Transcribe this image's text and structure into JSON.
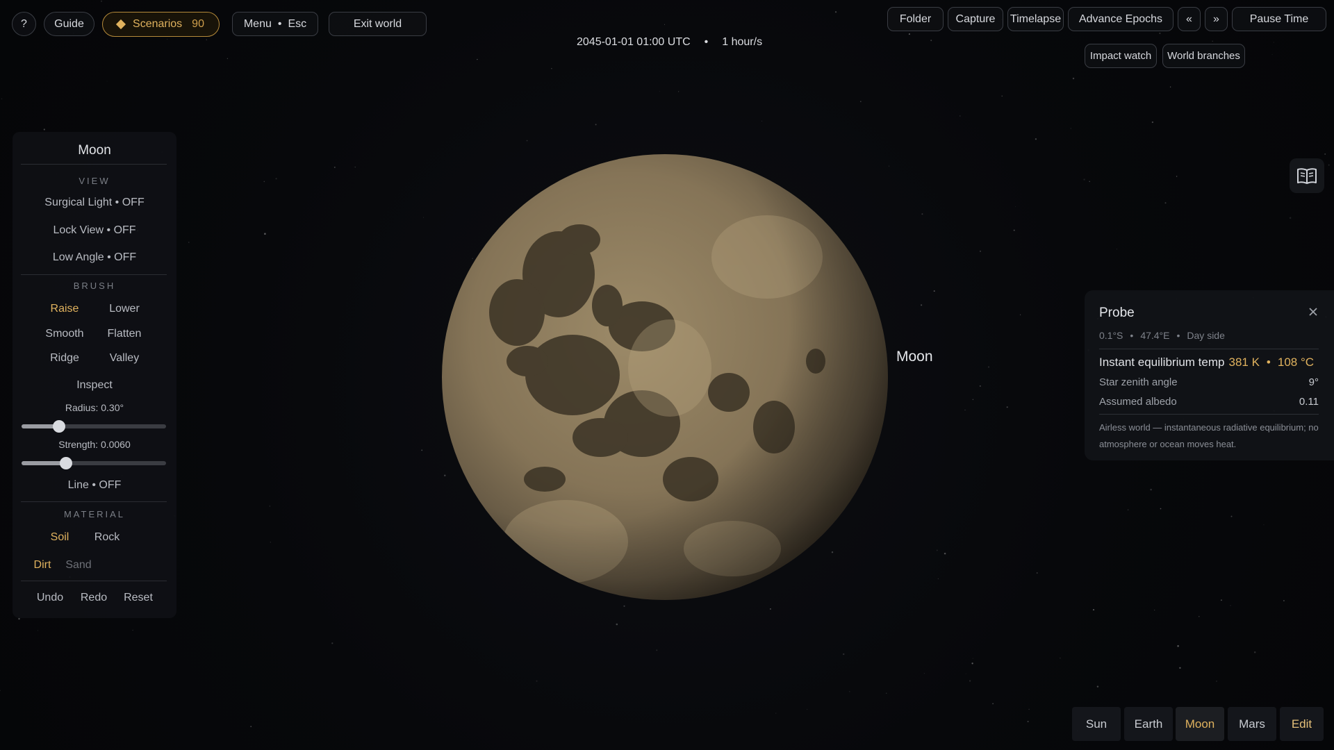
{
  "colors": {
    "accent": "#e0b25e",
    "background": "#06070a",
    "panel": "#101115",
    "text": "#cfd2d8",
    "moon_surface": "#8a7a5c"
  },
  "topbar_left": {
    "help_label": "?",
    "guide_label": "Guide",
    "scenarios_label": "Scenarios",
    "scenarios_count": "90",
    "menu_label": "Menu",
    "menu_key": "Esc",
    "exit_label": "Exit world"
  },
  "time": {
    "datetime": "2045-01-01 01:00 UTC",
    "rate": "1 hour/s",
    "separator": "•"
  },
  "topbar_right": {
    "folder_label": "Folder",
    "capture_label": "Capture",
    "timelapse_label": "Timelapse",
    "advance_label": "Advance Epochs",
    "prev_label": "«",
    "next_label": "»",
    "pause_label": "Pause Time",
    "impact_label": "Impact watch",
    "branches_label": "World branches"
  },
  "left_panel": {
    "title": "Moon",
    "view_heading": "VIEW",
    "surgical_light": "Surgical Light  •  OFF",
    "lock_view": "Lock View  •  OFF",
    "low_angle": "Low Angle  •  OFF",
    "brush_heading": "BRUSH",
    "brush_options": {
      "raise": "Raise",
      "lower": "Lower",
      "smooth": "Smooth",
      "flatten": "Flatten",
      "ridge": "Ridge",
      "valley": "Valley",
      "inspect": "Inspect"
    },
    "active_brush": "Raise",
    "radius_label": "Radius: 0.30°",
    "radius_fraction": 0.26,
    "strength_label": "Strength: 0.0060",
    "strength_fraction": 0.31,
    "line": "Line  •  OFF",
    "material_heading": "MATERIAL",
    "materials": {
      "soil": "Soil",
      "rock": "Rock"
    },
    "active_material": "Soil",
    "subtypes": {
      "dirt": "Dirt",
      "sand": "Sand"
    },
    "active_subtype": "Dirt",
    "undo_label": "Undo",
    "redo_label": "Redo",
    "reset_label": "Reset"
  },
  "moon_label": "Moon",
  "probe": {
    "title": "Probe",
    "lat": "0.1°S",
    "lon": "47.4°E",
    "side": "Day side",
    "dot": "•",
    "main_label": "Instant equilibrium temp",
    "temp_k": "381 K",
    "temp_c": "108 °C",
    "zenith_label": "Star zenith angle",
    "zenith_value": "9°",
    "albedo_label": "Assumed albedo",
    "albedo_value": "0.11",
    "note": "Airless world — instantaneous radiative equilibrium; no atmosphere or ocean moves heat."
  },
  "bodies": {
    "sun": "Sun",
    "earth": "Earth",
    "moon": "Moon",
    "mars": "Mars",
    "edit": "Edit"
  },
  "active_body": "Moon",
  "icons": {
    "book": "book-icon",
    "close": "close-icon",
    "scenarios": "diamond-icon"
  }
}
